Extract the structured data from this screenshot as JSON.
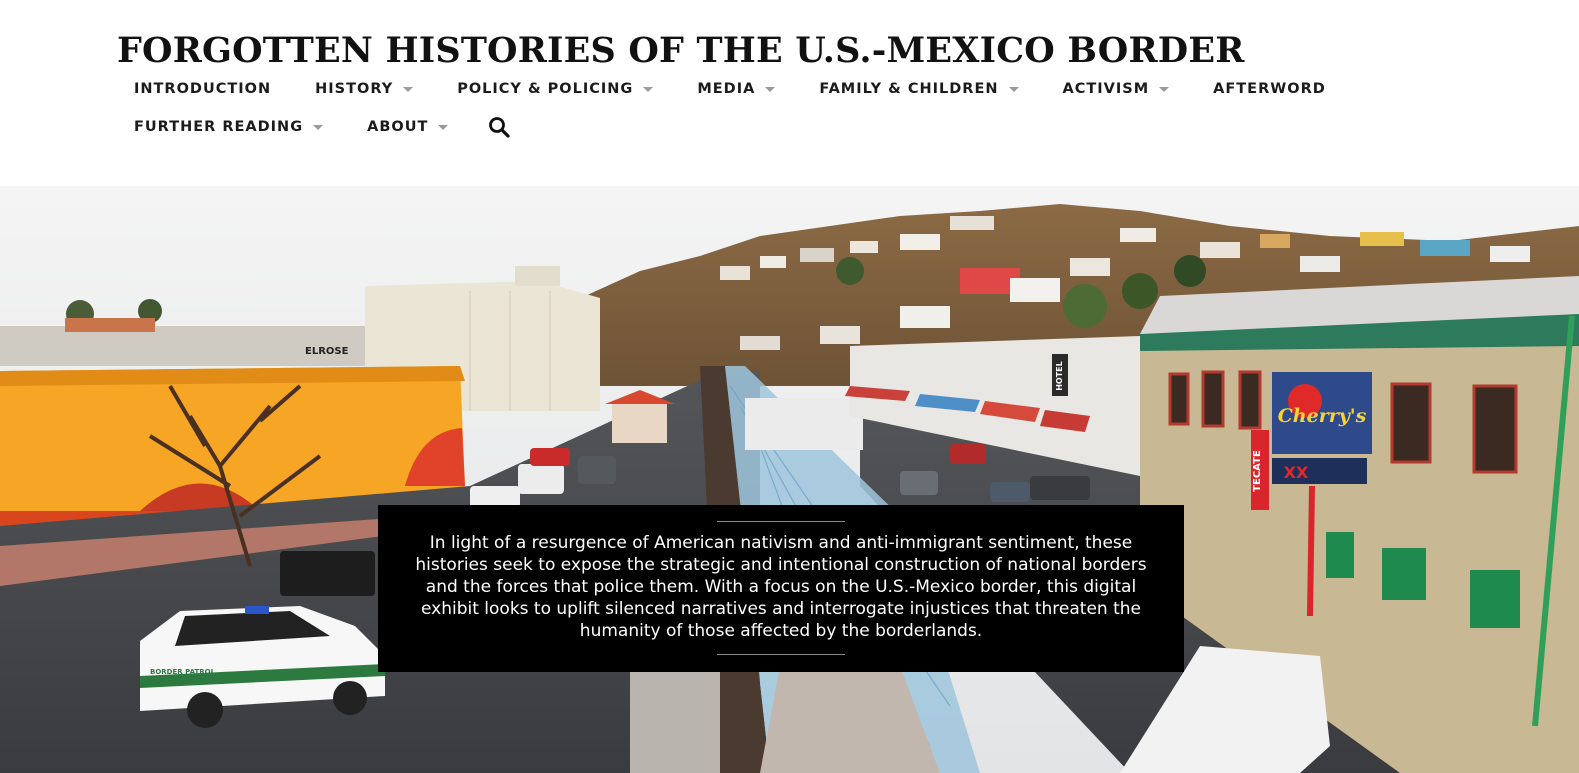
{
  "site": {
    "title": "FORGOTTEN HISTORIES OF THE U.S.-MEXICO BORDER"
  },
  "nav": {
    "row1": [
      {
        "label": "INTRODUCTION",
        "has_dropdown": false
      },
      {
        "label": "HISTORY",
        "has_dropdown": true
      },
      {
        "label": "POLICY & POLICING",
        "has_dropdown": true
      },
      {
        "label": "MEDIA",
        "has_dropdown": true
      },
      {
        "label": "FAMILY & CHILDREN",
        "has_dropdown": true
      },
      {
        "label": "ACTIVISM",
        "has_dropdown": true
      },
      {
        "label": "AFTERWORD",
        "has_dropdown": false
      }
    ],
    "row2": [
      {
        "label": "FURTHER READING",
        "has_dropdown": true
      },
      {
        "label": "ABOUT",
        "has_dropdown": true
      }
    ],
    "search_icon": "search-icon"
  },
  "hero": {
    "image": "border-street-scene",
    "signs": {
      "elrose": "ELROSE",
      "hotel": "HOTEL",
      "tecate": "TECATE",
      "cherrys": "Cherry's",
      "xx": "XX",
      "border_patrol": "BORDER PATROL"
    },
    "caption": "In light of a resurgence of American nativism and anti-immigrant sentiment, these histories seek to expose the strategic and intentional construction of national borders and the forces that police them. With a focus on the U.S.-Mexico border, this digital exhibit looks to uplift silenced narratives and interrogate injustices that threaten the humanity of those affected by the borderlands."
  },
  "colors": {
    "title_text": "#111111",
    "nav_text": "#1b1b1b",
    "caption_bg": "#000000",
    "caption_text": "#ffffff"
  }
}
